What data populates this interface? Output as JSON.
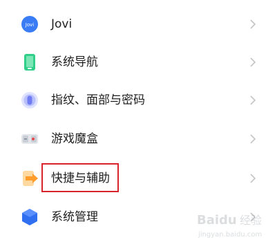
{
  "settings": {
    "items": [
      {
        "label": "Jovi",
        "icon": "jovi-icon"
      },
      {
        "label": "系统导航",
        "icon": "phone-navigation-icon"
      },
      {
        "label": "指纹、面部与密码",
        "icon": "fingerprint-icon"
      },
      {
        "label": "游戏魔盒",
        "icon": "game-box-icon"
      },
      {
        "label": "快捷与辅助",
        "icon": "shortcut-accessibility-icon"
      },
      {
        "label": "系统管理",
        "icon": "system-management-icon"
      }
    ],
    "highlighted_item": "快捷与辅助"
  },
  "watermark": {
    "text": "Baidu 经验",
    "subtext": "jingyan.baidu.com"
  },
  "colors": {
    "highlight": "#d8232a",
    "chevron": "#c4c4c4",
    "jovi": "#3a7cf5",
    "navigation": "#2fcf8a",
    "fingerprint": "#6f7cf2",
    "shortcut": "#ff9c2a",
    "system": "#2f6ff0"
  }
}
